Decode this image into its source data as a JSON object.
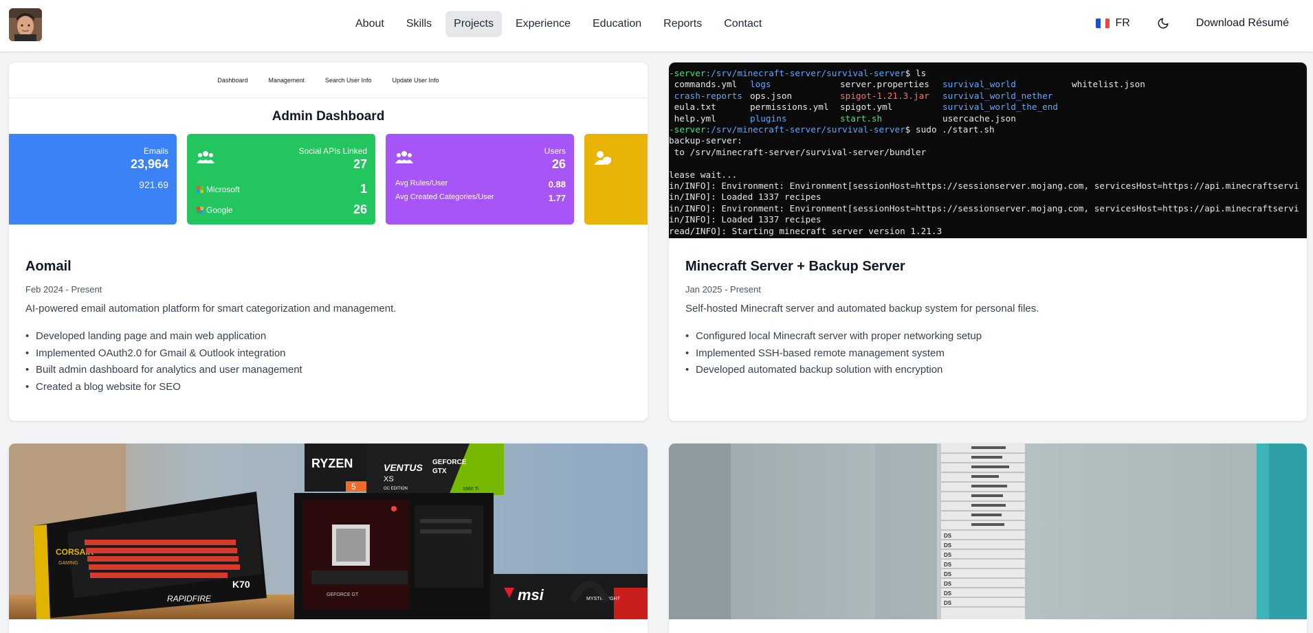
{
  "nav": {
    "links": [
      "About",
      "Skills",
      "Projects",
      "Experience",
      "Education",
      "Reports",
      "Contact"
    ],
    "active": "Projects",
    "lang_label": "FR",
    "resume_label": "Download Résumé"
  },
  "projects": [
    {
      "title": "Aomail",
      "date": "Feb 2024 - Present",
      "desc": "AI-powered email automation platform for smart categorization and management.",
      "bullets": [
        "Developed landing page and main web application",
        "Implemented OAuth2.0 for Gmail & Outlook integration",
        "Built admin dashboard for analytics and user management",
        "Created a blog website for SEO"
      ],
      "screenshot": {
        "tabs": [
          "Dashboard",
          "Management",
          "Search User Info",
          "Update User Info"
        ],
        "title": "Admin Dashboard",
        "cards": {
          "emails_label": "Emails",
          "emails_value": "23,964",
          "emails_sub": "921.69",
          "social_label": "Social APIs Linked",
          "social_value": "27",
          "microsoft_label": "Microsoft",
          "microsoft_value": "1",
          "google_label": "Google",
          "google_value": "26",
          "users_label": "Users",
          "users_value": "26",
          "avg_rules_label": "Avg Rules/User",
          "avg_rules_value": "0.88",
          "avg_cat_label": "Avg Created Categories/User",
          "avg_cat_value": "1.77"
        }
      }
    },
    {
      "title": "Minecraft Server + Backup Server",
      "date": "Jan 2025 - Present",
      "desc": "Self-hosted Minecraft server and automated backup system for personal files.",
      "bullets": [
        "Configured local Minecraft server with proper networking setup",
        "Implemented SSH-based remote management system",
        "Developed automated backup solution with encryption"
      ],
      "terminal": {
        "prompt1_prefix": "-server",
        "prompt_path": ":/srv/minecraft-server/survival-server",
        "cmd1": "$ ls",
        "files_row1": [
          " commands.yml",
          "logs",
          "server.properties",
          "survival_world",
          "whitelist.json"
        ],
        "files_row2": [
          " crash-reports",
          "ops.json",
          "spigot-1.21.3.jar",
          "survival_world_nether"
        ],
        "files_row3": [
          " eula.txt",
          "permissions.yml",
          "spigot.yml",
          "survival_world_the_end"
        ],
        "files_row4": [
          " help.yml",
          "plugins",
          "start.sh",
          "usercache.json"
        ],
        "cmd2": "$ sudo ./start.sh",
        "out1": "backup-server:",
        "out2": " to /srv/minecraft-server/survival-server/bundler",
        "out3": "lease wait...",
        "out4": "in/INFO]: Environment: Environment[sessionHost=https://sessionserver.mojang.com, servicesHost=https://api.minecraftservi",
        "out5": "in/INFO]: Loaded 1337 recipes",
        "out6": "in/INFO]: Environment: Environment[sessionHost=https://sessionserver.mojang.com, servicesHost=https://api.minecraftservi",
        "out7": "in/INFO]: Loaded 1337 recipes",
        "out8": "read/INFO]: Starting minecraft server version 1.21.3"
      }
    },
    {
      "photo_text": {
        "ryzen": "RYZEN",
        "ryzen_num": "5",
        "geforce": "GEFORCE",
        "gtx": "GTX",
        "gtx_model": "1660 Ti",
        "ventus": "VENTUS",
        "xs": "XS",
        "oc": "OC EDITION",
        "corsair": "CORSAIR",
        "gaming": "GAMING",
        "k70": "K70",
        "rapidfire": "RAPIDFIRE",
        "msi": "msi",
        "msi_gf": "GEFORCE GT",
        "mystic": "MYSTIC LIGHT"
      }
    },
    {
      "photo_text": {
        "ds": "DS"
      }
    }
  ],
  "colors": {
    "blue": "#3b82f6",
    "green": "#22c55e",
    "purple": "#a855f7",
    "yellow": "#eab308"
  }
}
